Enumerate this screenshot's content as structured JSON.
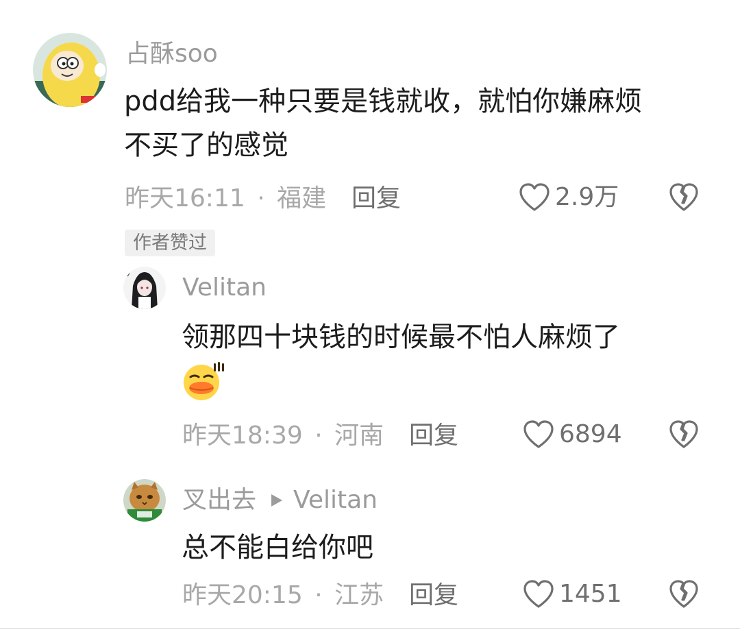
{
  "comments": [
    {
      "username": "占酥soo",
      "text_line1": "pdd给我一种只要是钱就收，就怕你嫌麻烦",
      "text_line2": "不买了的感觉",
      "time": "昨天16:11",
      "location": "福建",
      "reply_label": "回复",
      "likes": "2.9万",
      "badge": "作者赞过"
    },
    {
      "username": "Velitan",
      "text": "领那四十块钱的时候最不怕人麻烦了",
      "time": "昨天18:39",
      "location": "河南",
      "reply_label": "回复",
      "likes": "6894"
    },
    {
      "username": "叉出去",
      "reply_to": "Velitan",
      "text": "总不能白给你吧",
      "time": "昨天20:15",
      "location": "江苏",
      "reply_label": "回复",
      "likes": "1451"
    }
  ],
  "meta_separator": "·",
  "icons": {
    "like": "heart-outline-icon",
    "dislike": "broken-heart-icon",
    "reply_arrow": "play-triangle-icon",
    "emoji": "duck-sweat-emoji"
  },
  "colors": {
    "username": "#9b9b9b",
    "content": "#1c1c1c",
    "meta": "#a8a8a8",
    "action": "#6f6f6f",
    "badge_bg": "#f0f0f0"
  }
}
